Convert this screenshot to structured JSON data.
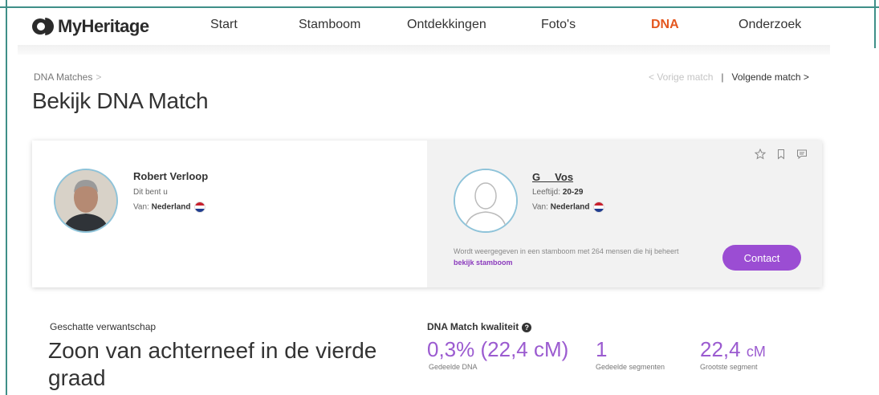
{
  "nav": {
    "logo": "MyHeritage",
    "items": [
      "Start",
      "Stamboom",
      "Ontdekkingen",
      "Foto's",
      "DNA",
      "Onderzoek"
    ],
    "active": "DNA"
  },
  "breadcrumb": {
    "label": "DNA Matches",
    "sep": ">"
  },
  "page_title": "Bekijk DNA Match",
  "match_nav": {
    "prev": "< Vorige match",
    "separator": "|",
    "next": "Volgende match >"
  },
  "user": {
    "name": "Robert Verloop",
    "subtitle": "Dit bent u",
    "from_label": "Van:",
    "country": "Nederland"
  },
  "match": {
    "name": "G     Vos",
    "age_label": "Leeftijd:",
    "age": "20-29",
    "from_label": "Van:",
    "country": "Nederland",
    "tree_note": "Wordt weergegeven in een stamboom met 264 mensen die hij beheert",
    "tree_link": "bekijk stamboom",
    "contact_label": "Contact"
  },
  "relationship": {
    "label": "Geschatte verwantschap",
    "value": "Zoon van achterneef in de vierde graad"
  },
  "quality": {
    "label": "DNA Match kwaliteit",
    "help": "?",
    "shared_dna_pct": "0,3%",
    "shared_dna_cm": "(22,4 cM)",
    "shared_dna_label": "Gedeelde DNA",
    "segments_value": "1",
    "segments_label": "Gedeelde segmenten",
    "largest_value": "22,4",
    "largest_unit": "cM",
    "largest_label": "Grootste segment"
  },
  "colors": {
    "accent_purple": "#9b4dd3",
    "active_nav": "#e4571f",
    "frame": "#3f8f88"
  }
}
